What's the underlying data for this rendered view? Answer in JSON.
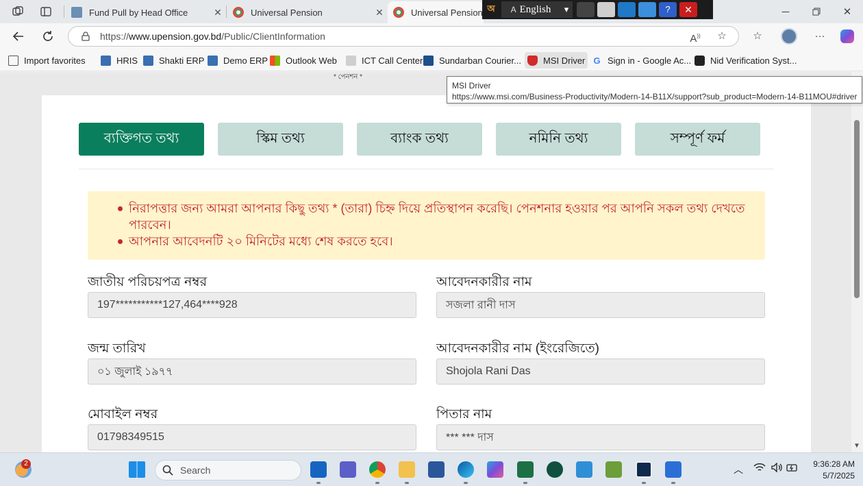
{
  "tabs": [
    {
      "title": "Fund Pull by Head Office"
    },
    {
      "title": "Universal Pension"
    },
    {
      "title": "Universal Pension"
    }
  ],
  "langbar": {
    "language": "English"
  },
  "address": {
    "url_prefix": "https://",
    "url_host": "www.upension.gov.bd",
    "url_path": "/Public/ClientInformation"
  },
  "favorites": [
    {
      "label": "Import favorites",
      "color": "#555555"
    },
    {
      "label": "HRIS",
      "color": "#3a6fb0"
    },
    {
      "label": "Shakti ERP",
      "color": "#3a6fb0"
    },
    {
      "label": "Demo ERP",
      "color": "#3a6fb0"
    },
    {
      "label": "Outlook Web",
      "color": "#e2a400"
    },
    {
      "label": "ICT Call Center",
      "color": "#b0b0b0"
    },
    {
      "label": "Sundarban Courier...",
      "color": "#1f4f8a"
    },
    {
      "label": "MSI Driver",
      "color": "#d12b2b"
    },
    {
      "label": "Sign in - Google Ac...",
      "color": "#4285f4"
    },
    {
      "label": "Nid Verification Syst...",
      "color": "#222222"
    }
  ],
  "tooltip": {
    "title": "MSI Driver",
    "url": "https://www.msi.com/Business-Productivity/Modern-14-B11X/support?sub_product=Modern-14-B11MOU#driver"
  },
  "page": {
    "top_cut_text": "* পেনশন *",
    "steps": [
      {
        "label": "ব্যক্তিগত তথ্য",
        "active": true
      },
      {
        "label": "স্কিম তথ্য",
        "active": false
      },
      {
        "label": "ব্যাংক তথ্য",
        "active": false
      },
      {
        "label": "নমিনি তথ্য",
        "active": false
      },
      {
        "label": "সম্পূর্ণ ফর্ম",
        "active": false
      }
    ],
    "notices": [
      "নিরাপত্তার জন্য আমরা আপনার কিছু তথ্য * (তারা) চিহ্ন দিয়ে প্রতিস্থাপন করেছি। পেনশনার হওয়ার পর আপনি সকল তথ্য দেখতে পারবেন।",
      "আপনার আবেদনটি ২০ মিনিটের মধ্যে শেষ করতে হবে।"
    ],
    "fields": {
      "nid": {
        "label": "জাতীয় পরিচয়পত্র নম্বর",
        "value": "197***********127,464****928"
      },
      "applicant_name": {
        "label": "আবেদনকারীর নাম",
        "value": "সজলা রানী দাস"
      },
      "dob": {
        "label": "জন্ম তারিখ",
        "value": "০১ জুলাই ১৯৭৭"
      },
      "applicant_name_en": {
        "label": "আবেদনকারীর নাম (ইংরেজিতে)",
        "value": "Shojola Rani Das"
      },
      "mobile": {
        "label": "মোবাইল নম্বর",
        "value": "01798349515"
      },
      "father_name": {
        "label": "পিতার নাম",
        "value": "*** *** দাস"
      }
    }
  },
  "taskbar": {
    "search_placeholder": "Search",
    "notification_count": "2",
    "time": "9:36:28 AM",
    "date": "5/7/2025"
  },
  "colors": {
    "step_active": "#0a7f5d",
    "step_inactive": "#c5dcd7",
    "notice_bg": "#fff4cc",
    "notice_text": "#c6282b"
  }
}
